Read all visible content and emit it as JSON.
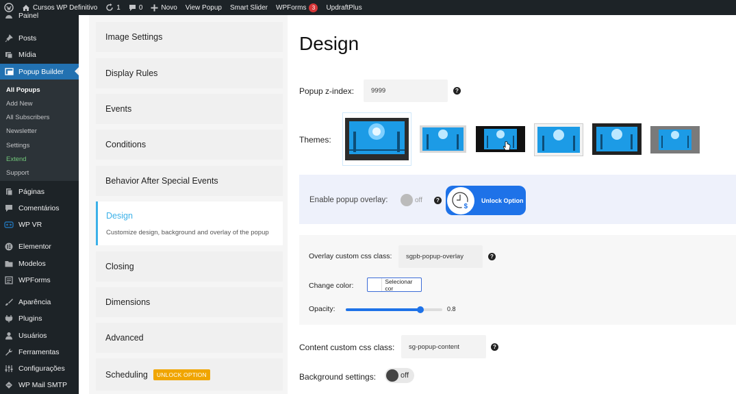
{
  "adminbar": {
    "site_name": "Cursos WP Definitivo",
    "updates_count": "1",
    "comments_count": "0",
    "new_label": "Novo",
    "view_popup": "View Popup",
    "smart_slider": "Smart Slider",
    "wpforms": "WPForms",
    "wpforms_badge": "3",
    "updraft": "UpdraftPlus"
  },
  "sidebar": {
    "items": [
      {
        "label": "Painel",
        "icon": "dashboard-icon"
      },
      {
        "label": "Posts",
        "icon": "pin-icon"
      },
      {
        "label": "Mídia",
        "icon": "media-icon"
      },
      {
        "label": "Popup Builder",
        "icon": "popup-icon"
      },
      {
        "label": "Páginas",
        "icon": "page-icon"
      },
      {
        "label": "Comentários",
        "icon": "comment-icon"
      },
      {
        "label": "WP VR",
        "icon": "vr-icon"
      },
      {
        "label": "Elementor",
        "icon": "elementor-icon"
      },
      {
        "label": "Modelos",
        "icon": "folder-icon"
      },
      {
        "label": "WPForms",
        "icon": "form-icon"
      },
      {
        "label": "Aparência",
        "icon": "brush-icon"
      },
      {
        "label": "Plugins",
        "icon": "plugin-icon"
      },
      {
        "label": "Usuários",
        "icon": "user-icon"
      },
      {
        "label": "Ferramentas",
        "icon": "wrench-icon"
      },
      {
        "label": "Configurações",
        "icon": "settings-icon"
      },
      {
        "label": "WP Mail SMTP",
        "icon": "mail-icon"
      }
    ],
    "submenu": [
      "All Popups",
      "Add New",
      "All Subscribers",
      "Newsletter",
      "Settings",
      "Extend",
      "Support"
    ]
  },
  "tabs": [
    {
      "title": "Image Settings"
    },
    {
      "title": "Display Rules"
    },
    {
      "title": "Events"
    },
    {
      "title": "Conditions"
    },
    {
      "title": "Behavior After Special Events"
    },
    {
      "title": "Design",
      "desc": "Customize design, background and overlay of the popup"
    },
    {
      "title": "Closing"
    },
    {
      "title": "Dimensions"
    },
    {
      "title": "Advanced"
    },
    {
      "title": "Scheduling",
      "badge": "UNLOCK OPTION"
    }
  ],
  "design": {
    "heading": "Design",
    "zindex_label": "Popup z-index:",
    "zindex_value": "9999",
    "themes_label": "Themes:",
    "overlay_label": "Enable popup overlay:",
    "overlay_state": "off",
    "unlock_label": "Unlock Option",
    "overlay_class_label": "Overlay custom css class:",
    "overlay_class_value": "sgpb-popup-overlay",
    "change_color_label": "Change color:",
    "color_button": "Selecionar cor",
    "opacity_label": "Opacity:",
    "opacity_value": "0.8",
    "content_class_label": "Content custom css class:",
    "content_class_value": "sg-popup-content",
    "bg_settings_label": "Background settings:",
    "bg_state": "off",
    "help_glyph": "?"
  },
  "colors": {
    "accent": "#2271b1",
    "tab_active": "#3ab0e8",
    "unlock_blue": "#1e72e8",
    "badge_orange": "#f0a500"
  }
}
